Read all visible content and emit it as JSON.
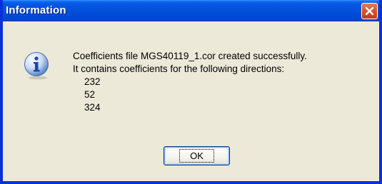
{
  "window": {
    "title": "Information"
  },
  "message": {
    "line1": "Coefficients file MGS40119_1.cor created successfully.",
    "line2": "It contains coefficients for the following directions:",
    "directions": [
      "232",
      "52",
      "324"
    ]
  },
  "buttons": {
    "ok_label": "OK"
  },
  "icons": {
    "dialog_icon": "info-icon",
    "close_icon": "close-icon"
  },
  "colors": {
    "titlebar": "#0050da",
    "close_button": "#d9532c",
    "dialog_background": "#ece9d8",
    "border": "#0831d9"
  }
}
